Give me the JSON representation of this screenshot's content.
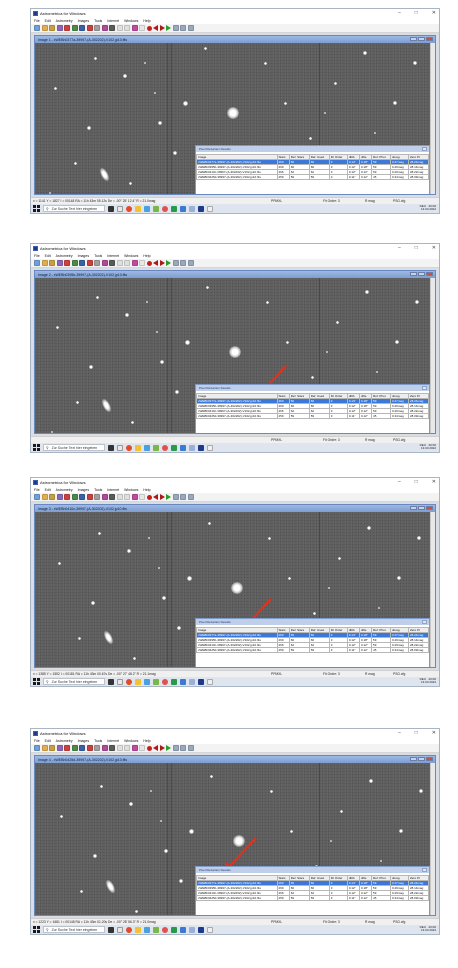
{
  "app": {
    "title": "Astrometrica for Windows",
    "window_buttons": [
      "–",
      "□",
      "✕"
    ],
    "menu": [
      "File",
      "Edit",
      "Astrometry",
      "Images",
      "Tools",
      "Internet",
      "Windows",
      "Help"
    ]
  },
  "taskbar": {
    "search_placeholder": "Zur Suche Text hier eingeben",
    "language": "DEU",
    "clock_time": "20:00",
    "clock_date": "13.03.2022"
  },
  "results_window": {
    "title": "Pixel Reduction Results",
    "columns": [
      "Image",
      "Stars",
      "Ref. Stars",
      "Ref. Used",
      "Fit Order",
      "dRA",
      "dDe",
      "Ref. Phot",
      "dmag",
      "Zero Pt"
    ],
    "rows": [
      [
        "xWEBh0377a-39997-(A-302202)-V102.jp10.fits",
        "260",
        "66",
        "66",
        "3",
        "0.14\"",
        "0.18\"",
        "59",
        "0.27mag",
        "28.24mag"
      ],
      [
        "xWEBh0395b-39997-(A-302202)-V102.jp10.fits",
        "269",
        "66",
        "66",
        "3",
        "0.12\"",
        "0.18\"",
        "59",
        "0.29mag",
        "28.14mag"
      ],
      [
        "xWEBh0410c-39997-(A-302202)-V102.jp10.fits",
        "266",
        "62",
        "62",
        "3",
        "0.12\"",
        "0.12\"",
        "59",
        "0.29mag",
        "28.22mag"
      ],
      [
        "xWEBh0425d-39997-(A-302202)-V102.jp10.fits",
        "259",
        "59",
        "59",
        "3",
        "0.11\"",
        "0.12\"",
        "45",
        "0.34mag",
        "28.09mag"
      ]
    ]
  },
  "frames": [
    {
      "child_title": "Image 1 - xWEBh0377a-39997-(A-302202)-V102.jp10.fits",
      "status_coords": "x = 1141  Y = 1827  I = 00148  RA = 11h 43m 05.12s  De = -00° 25' 12.4\"  R = 21.0mag",
      "status_ppmxl": "PPMXL",
      "status_fit": "Fit Order: 3",
      "status_rmag": "R mag",
      "status_psf": "PSG.cfg",
      "selected_row": 0
    },
    {
      "child_title": "Image 2 - xWEBh0395b-39997-(A-302202)-V102.jp10.fits",
      "status_coords": "",
      "status_ppmxl": "PPMXL",
      "status_fit": "Fit Order: 3",
      "status_rmag": "R mag",
      "status_psf": "PSG.cfg",
      "selected_row": 0
    },
    {
      "child_title": "Image 3 - xWEBh0410c-39997-(A-302202)-V102.jp10.fits",
      "status_coords": "x = 1385  Y = 1552  I = 00181  RA = 11h 43m 00.67s  De = -00° 27' 48.2\"  R = 21.1mag",
      "status_ppmxl": "PPMXL",
      "status_fit": "Fit Order: 3",
      "status_rmag": "R mag",
      "status_psf": "PSG.cfg",
      "selected_row": 0
    },
    {
      "child_title": "Image 4 - xWEBh0425d-39997-(A-302202)-V102.jp10.fits",
      "status_coords": "x = 1223  Y = 1681  I = 00148  RA = 11h 43m 01.20s  De = -00° 28' 56.3\"  R = 21.0mag",
      "status_ppmxl": "PPMXL",
      "status_fit": "Fit Order: 3",
      "status_rmag": "R mag",
      "status_psf": "PSG.cfg",
      "selected_row": 0
    }
  ],
  "colors": {
    "arrow": "#e0321c",
    "selection": "#3c78d8",
    "sky": "#585858"
  },
  "icons": [
    "app-icon",
    "open-icon",
    "save-icon",
    "star-icon",
    "prev-icon",
    "next-icon",
    "play-icon",
    "windows-start-icon",
    "search-icon"
  ]
}
